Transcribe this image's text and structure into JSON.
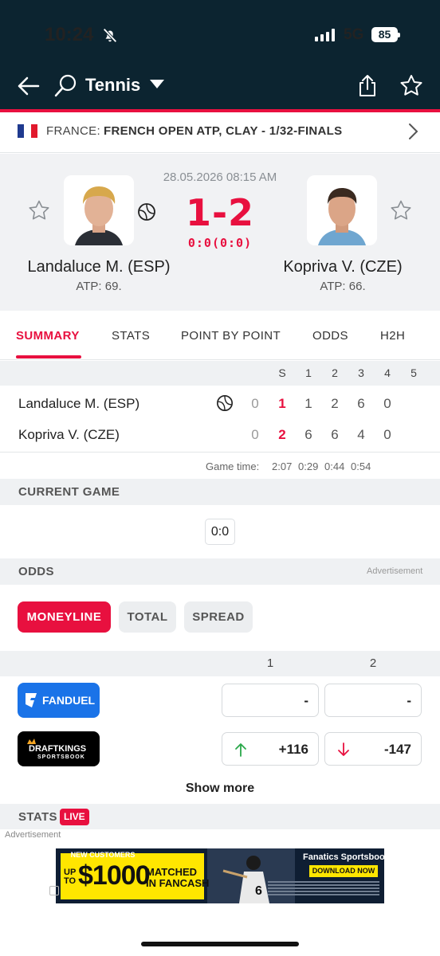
{
  "status_bar": {
    "time": "10:24",
    "network": "5G",
    "battery": "85"
  },
  "header": {
    "title": "Tennis"
  },
  "tournament": {
    "country": "FRANCE:",
    "name": "FRENCH OPEN ATP, CLAY - 1/32-FINALS"
  },
  "match": {
    "datetime": "28.05.2026 08:15 AM",
    "score": "1-2",
    "game_score": "0:0(0:0)",
    "home": {
      "name": "Landaluce M. (ESP)",
      "rank": "ATP: 69."
    },
    "away": {
      "name": "Kopriva V. (CZE)",
      "rank": "ATP: 66."
    }
  },
  "tabs": [
    "SUMMARY",
    "STATS",
    "POINT BY POINT",
    "ODDS",
    "H2H"
  ],
  "score_table": {
    "columns": [
      "S",
      "1",
      "2",
      "3",
      "4",
      "5"
    ],
    "rows": [
      {
        "name": "Landaluce M. (ESP)",
        "cells": [
          "0",
          "1",
          "1",
          "2",
          "6",
          "0"
        ]
      },
      {
        "name": "Kopriva V. (CZE)",
        "cells": [
          "0",
          "2",
          "6",
          "6",
          "4",
          "0"
        ]
      }
    ],
    "game_time_label": "Game time:",
    "game_times": [
      "2:07",
      "0:29",
      "0:44",
      "0:54"
    ]
  },
  "current_game": {
    "title": "CURRENT GAME",
    "score": "0:0"
  },
  "odds": {
    "title": "ODDS",
    "advertisement": "Advertisement",
    "pills": [
      "MONEYLINE",
      "TOTAL",
      "SPREAD"
    ],
    "columns": [
      "1",
      "2"
    ],
    "books": [
      {
        "name": "FANDUEL",
        "odd1": "-",
        "odd2": "-"
      },
      {
        "name": "DRAFTKINGS",
        "sub": "SPORTSBOOK",
        "odd1": "+116",
        "odd2": "-147"
      }
    ],
    "show_more": "Show more"
  },
  "stats": {
    "title": "STATS",
    "live": "LIVE"
  },
  "ad": {
    "label": "Advertisement",
    "line1": "NEW CUSTOMERS",
    "upto": "UP TO",
    "amount": "$1000",
    "matched": "MATCHED IN FANCASH",
    "brand": "Fanatics Sportsbook",
    "cta": "DOWNLOAD NOW"
  },
  "colors": {
    "accent": "#e8103f",
    "header_bg": "#0c2430",
    "fanduel": "#1a73e8"
  }
}
